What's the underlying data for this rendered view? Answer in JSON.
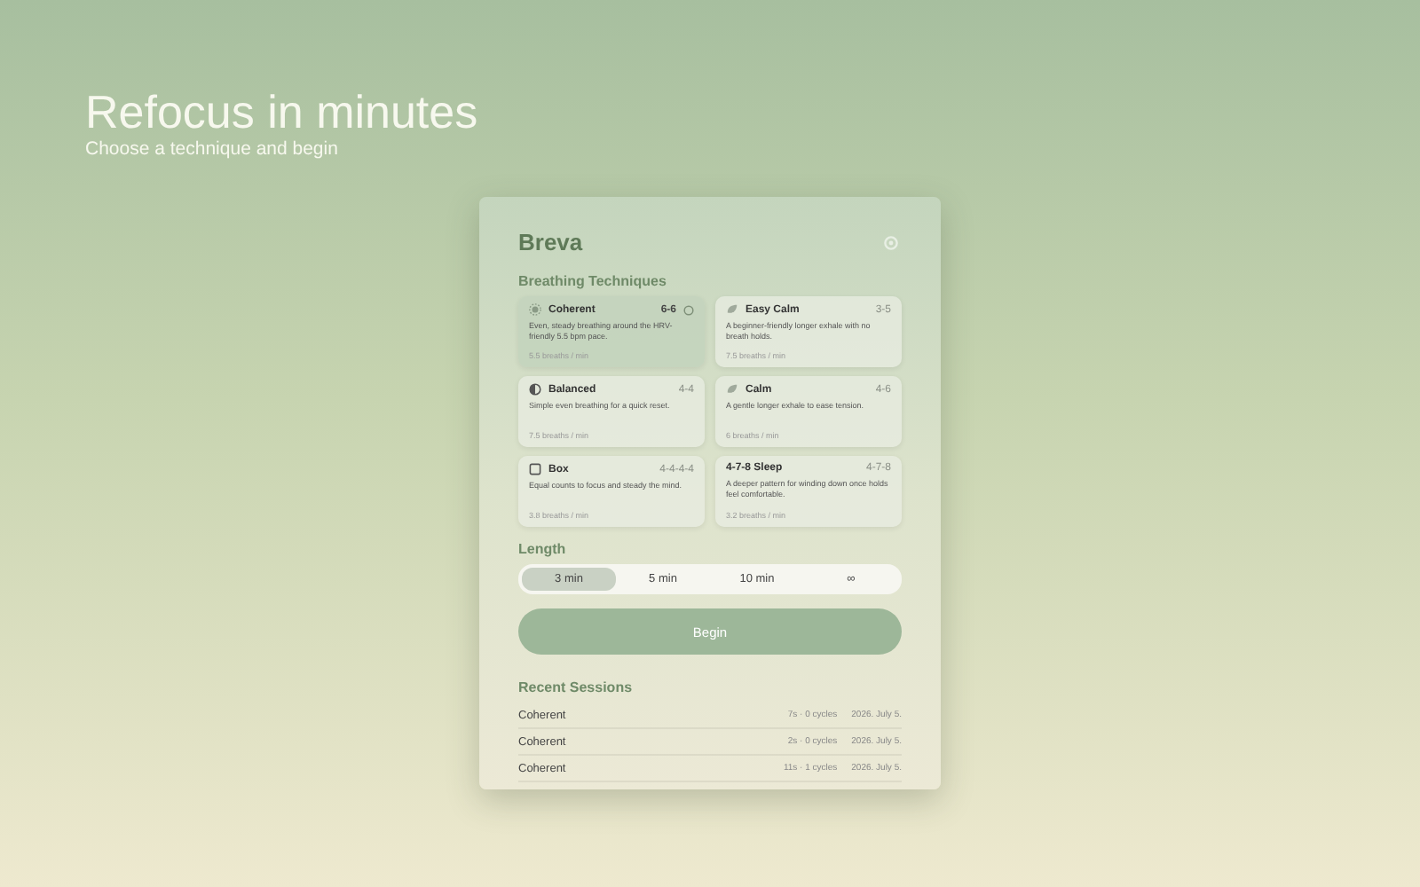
{
  "hero": {
    "title": "Refocus in minutes",
    "subtitle": "Choose a technique and begin"
  },
  "app": {
    "name": "Breva",
    "techniques_heading": "Breathing Techniques",
    "techniques": [
      {
        "kind": "sun",
        "name": "Coherent",
        "pattern": "6-6",
        "description": "Even, steady breathing around the HRV-friendly 5.5 bpm pace.",
        "rate": "5.5 breaths / min",
        "selected": true
      },
      {
        "kind": "leaf",
        "name": "Easy Calm",
        "pattern": "3-5",
        "description": "A beginner-friendly longer exhale with no breath holds.",
        "rate": "7.5 breaths / min",
        "selected": false
      },
      {
        "kind": "half",
        "name": "Balanced",
        "pattern": "4-4",
        "description": "Simple even breathing for a quick reset.",
        "rate": "7.5 breaths / min",
        "selected": false
      },
      {
        "kind": "leaf",
        "name": "Calm",
        "pattern": "4-6",
        "description": "A gentle longer exhale to ease tension.",
        "rate": "6 breaths / min",
        "selected": false
      },
      {
        "kind": "square",
        "name": "Box",
        "pattern": "4-4-4-4",
        "description": "Equal counts to focus and steady the mind.",
        "rate": "3.8 breaths / min",
        "selected": false
      },
      {
        "kind": "plain",
        "name": "4-7-8 Sleep",
        "pattern": "4-7-8",
        "description": "A deeper pattern for winding down once holds feel comfortable.",
        "rate": "3.2 breaths / min",
        "selected": false
      }
    ],
    "length_heading": "Length",
    "lengths": [
      {
        "label": "3 min",
        "selected": true
      },
      {
        "label": "5 min",
        "selected": false
      },
      {
        "label": "10 min",
        "selected": false
      },
      {
        "label": "∞",
        "selected": false
      }
    ],
    "begin_button": "Begin",
    "recent_heading": "Recent Sessions",
    "sessions": [
      {
        "name": "Coherent",
        "stats": "7s · 0 cycles",
        "date": "2026. July 5."
      },
      {
        "name": "Coherent",
        "stats": "2s · 0 cycles",
        "date": "2026. July 5."
      },
      {
        "name": "Coherent",
        "stats": "11s · 1 cycles",
        "date": "2026. July 5."
      }
    ]
  }
}
